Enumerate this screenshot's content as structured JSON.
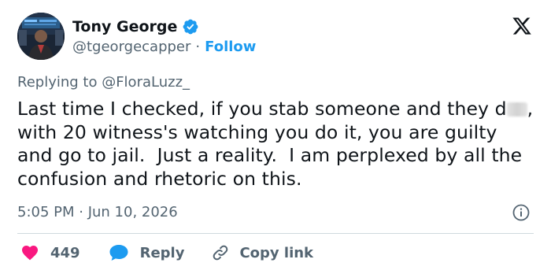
{
  "author": {
    "display_name": "Tony George",
    "handle": "@tgeorgecapper",
    "separator": "·",
    "follow_label": "Follow",
    "verified": true
  },
  "reply_context": {
    "prefix": "Replying to ",
    "mention": "@FloraLuzz_"
  },
  "tweet": {
    "text_before_blur": "Last time I checked, if you stab someone and they d",
    "text_after_blur": ", with 20 witness's watching you do it, you are guilty and go to jail.  Just a reality.  I am perplexed by all the confusion and rhetoric on this.",
    "timestamp": "5:05 PM · Jun 10, 2026"
  },
  "actions": {
    "like_count": "449",
    "reply_label": "Reply",
    "copy_link_label": "Copy link"
  },
  "icons": {
    "logo": "x-logo-icon",
    "verified": "verified-badge-icon",
    "info": "info-icon",
    "like": "heart-icon",
    "reply": "speech-bubble-icon",
    "copy": "link-icon"
  },
  "colors": {
    "accent": "#1d9bf0",
    "like": "#f91880",
    "secondary_text": "#536471",
    "primary_text": "#0f1419",
    "divider": "#cfd9de"
  }
}
